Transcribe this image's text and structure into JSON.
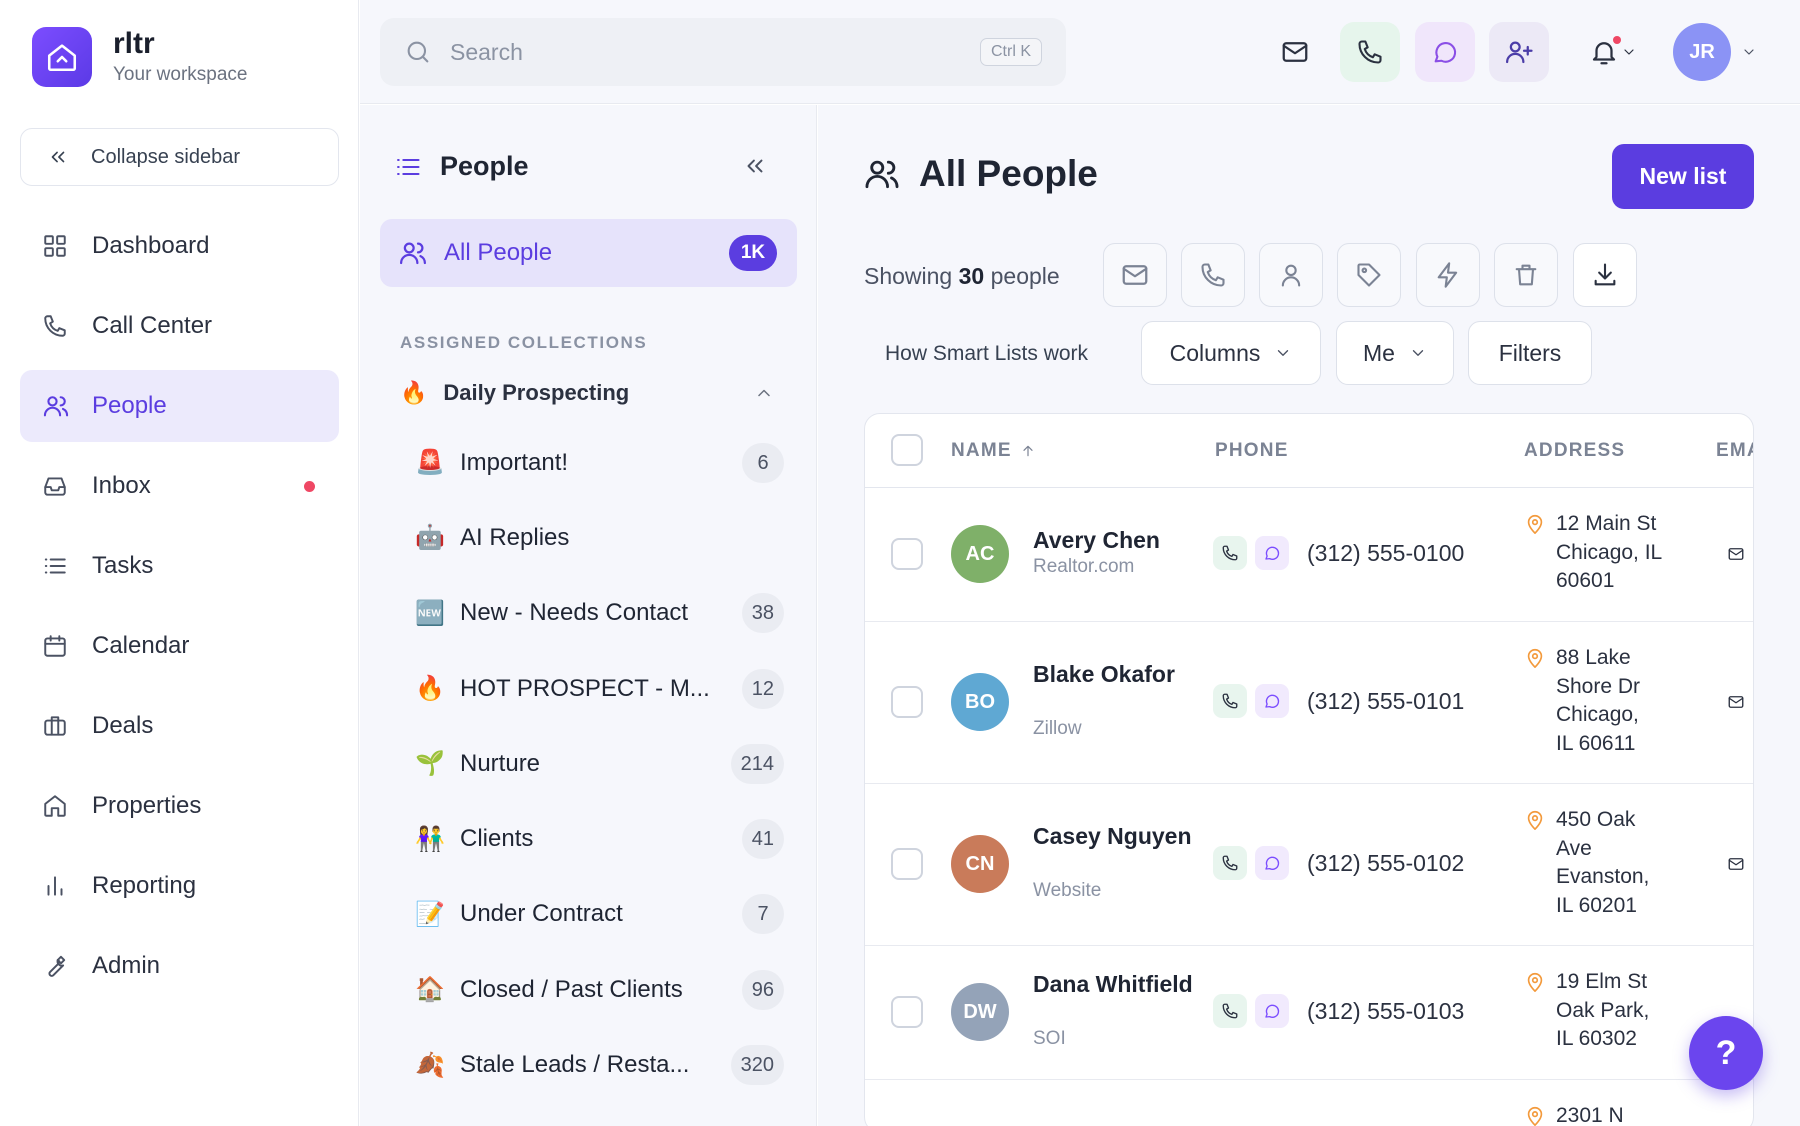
{
  "brand": {
    "name": "rltr",
    "subtitle": "Your workspace"
  },
  "sidebar": {
    "collapse_label": "Collapse sidebar",
    "items": [
      {
        "label": "Dashboard",
        "icon": "grid-icon",
        "active": false
      },
      {
        "label": "Call Center",
        "icon": "phone-icon",
        "active": false
      },
      {
        "label": "People",
        "icon": "users-icon",
        "active": true
      },
      {
        "label": "Inbox",
        "icon": "inbox-icon",
        "active": false,
        "unread_dot": true
      },
      {
        "label": "Tasks",
        "icon": "list-icon",
        "active": false
      },
      {
        "label": "Calendar",
        "icon": "calendar-icon",
        "active": false
      },
      {
        "label": "Deals",
        "icon": "briefcase-icon",
        "active": false
      },
      {
        "label": "Properties",
        "icon": "home-icon",
        "active": false
      },
      {
        "label": "Reporting",
        "icon": "bar-chart-icon",
        "active": false
      },
      {
        "label": "Admin",
        "icon": "wrench-icon",
        "active": false
      }
    ]
  },
  "topbar": {
    "search_placeholder": "Search",
    "search_shortcut": "Ctrl K",
    "user_initials": "JR"
  },
  "collections": {
    "title": "People",
    "all_people_label": "All People",
    "all_people_count": "1K",
    "section_label": "ASSIGNED COLLECTIONS",
    "group_name": "Daily Prospecting",
    "items": [
      {
        "label": "Important!",
        "count": "6",
        "emoji": "🚨"
      },
      {
        "label": "AI Replies",
        "count": "",
        "emoji": "🤖"
      },
      {
        "label": "New - Needs Contact",
        "count": "38",
        "emoji": "🆕"
      },
      {
        "label": "HOT PROSPECT - M...",
        "count": "12",
        "emoji": "🔥"
      },
      {
        "label": "Nurture",
        "count": "214",
        "emoji": "🌱"
      },
      {
        "label": "Clients",
        "count": "41",
        "emoji": "👫"
      },
      {
        "label": "Under Contract",
        "count": "7",
        "emoji": "📝"
      },
      {
        "label": "Closed / Past Clients",
        "count": "96",
        "emoji": "🏠"
      },
      {
        "label": "Stale Leads / Resta...",
        "count": "320",
        "emoji": "🍂"
      }
    ]
  },
  "main": {
    "title": "All People",
    "new_list_label": "New list",
    "showing_prefix": "Showing",
    "showing_count": "30",
    "showing_suffix": "people",
    "how_label": "How Smart Lists work",
    "columns_label": "Columns",
    "owner_label": "Me",
    "filters_label": "Filters",
    "table": {
      "headers": {
        "name": "NAME",
        "phone": "PHONE",
        "address": "ADDRESS",
        "email": "EMA"
      },
      "rows": [
        {
          "initials": "AC",
          "avatar_color": "#7fb069",
          "name": "Avery Chen",
          "source": "Realtor.com",
          "phone": "(312) 555-0100",
          "address": "12 Main St Chicago, IL 60601"
        },
        {
          "initials": "BO",
          "avatar_color": "#5fa8d3",
          "name": "Blake Okafor",
          "source": "Zillow",
          "phone": "(312) 555-0101",
          "address": "88 Lake Shore Dr Chicago, IL 60611"
        },
        {
          "initials": "CN",
          "avatar_color": "#c97b5a",
          "name": "Casey Nguyen",
          "source": "Website",
          "phone": "(312) 555-0102",
          "address": "450 Oak Ave Evanston, IL 60201"
        },
        {
          "initials": "DW",
          "avatar_color": "#94a3b8",
          "name": "Dana Whitfield",
          "source": "SOI",
          "phone": "(312) 555-0103",
          "address": "19 Elm St Oak Park, IL 60302"
        },
        {
          "initials": "",
          "avatar_color": "",
          "name": "",
          "source": "",
          "phone": "",
          "address": "2301 N"
        }
      ]
    }
  },
  "help_label": "?"
}
